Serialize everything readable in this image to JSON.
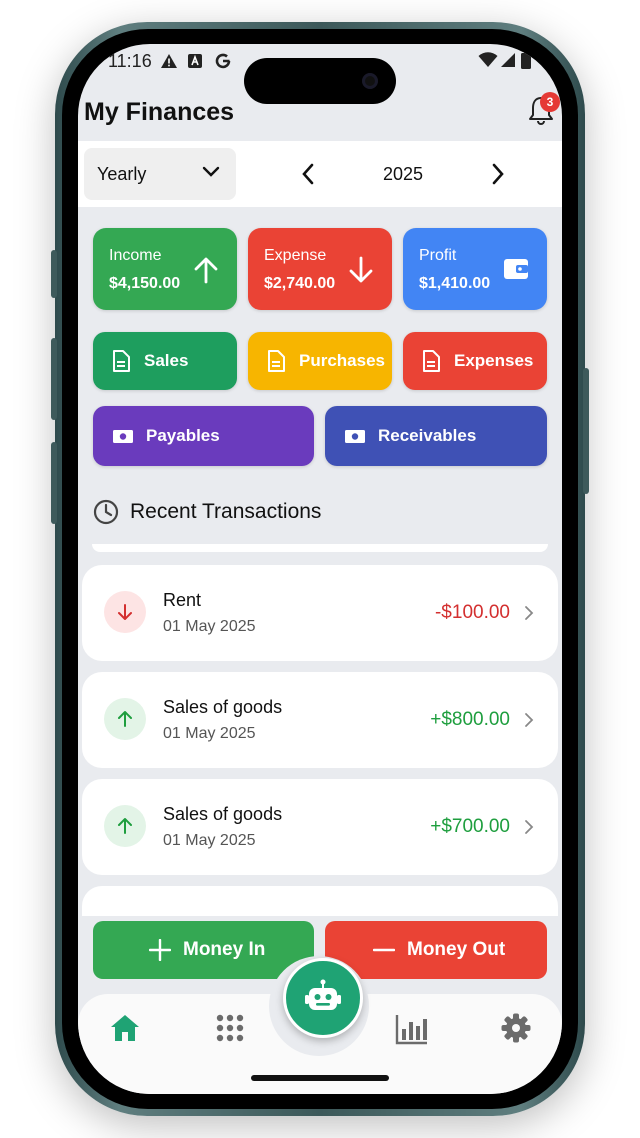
{
  "status_bar": {
    "time": "11:16"
  },
  "header": {
    "title": "My Finances",
    "notification_count": "3"
  },
  "filter": {
    "period": "Yearly",
    "year": "2025"
  },
  "summary": [
    {
      "label": "Income",
      "value": "$4,150.00",
      "color": "#34a853",
      "icon": "arrow-up-icon"
    },
    {
      "label": "Expense",
      "value": "$2,740.00",
      "color": "#ea4335",
      "icon": "arrow-down-icon"
    },
    {
      "label": "Profit",
      "value": "$1,410.00",
      "color": "#4285f4",
      "icon": "wallet-icon"
    }
  ],
  "categories": [
    {
      "label": "Sales",
      "color": "#1e9e5e",
      "icon": "document-icon"
    },
    {
      "label": "Purchases",
      "color": "#f7b500",
      "icon": "document-icon"
    },
    {
      "label": "Expenses",
      "color": "#ea4335",
      "icon": "document-icon"
    }
  ],
  "accounts": [
    {
      "label": "Payables",
      "color": "#6a3bbd",
      "icon": "cash-icon"
    },
    {
      "label": "Receivables",
      "color": "#3f51b5",
      "icon": "cash-icon"
    }
  ],
  "recent": {
    "title": "Recent Transactions",
    "transactions": [
      {
        "name": "Rent",
        "date": "01 May 2025",
        "amount": "-$100.00",
        "type": "expense"
      },
      {
        "name": "Sales of goods",
        "date": "01 May 2025",
        "amount": "+$800.00",
        "type": "income"
      },
      {
        "name": "Sales of goods",
        "date": "01 May 2025",
        "amount": "+$700.00",
        "type": "income"
      }
    ]
  },
  "actions": {
    "money_in": "Money In",
    "money_out": "Money Out"
  },
  "nav": [
    "home-icon",
    "grid-icon",
    "robot-icon",
    "bar-chart-icon",
    "settings-icon"
  ],
  "colors": {
    "income_text": "#1e9e3e",
    "expense_text": "#d32f2f",
    "fab": "#1fa374",
    "nav_active": "#1fa374",
    "nav_inactive": "#6b6b6b"
  }
}
